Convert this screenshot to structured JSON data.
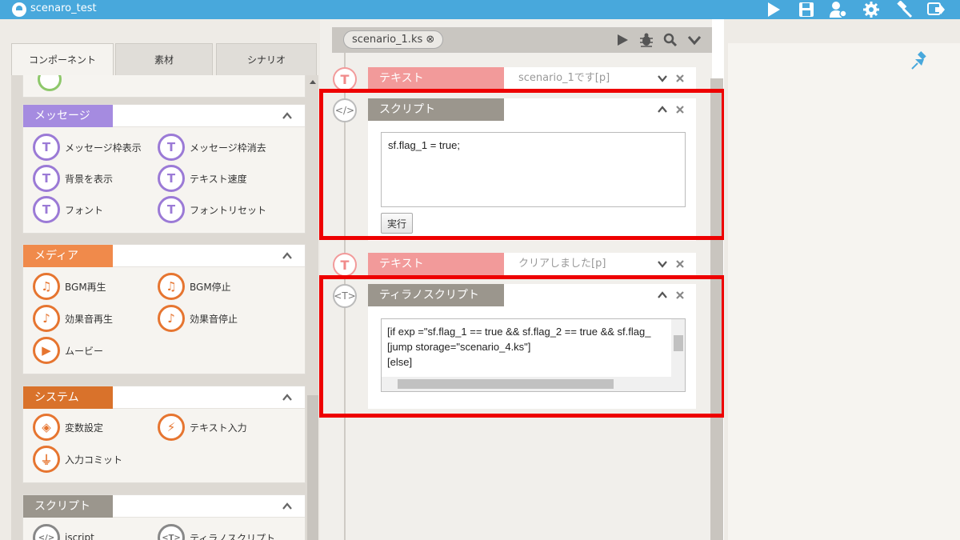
{
  "app": {
    "title": "scenaro_test"
  },
  "left": {
    "tabs": [
      "コンポーネント",
      "素材",
      "シナリオ"
    ],
    "categories": {
      "message": {
        "label": "メッセージ",
        "color": "#a58be0",
        "items": [
          "メッセージ枠表示",
          "メッセージ枠消去",
          "背景を表示",
          "テキスト速度",
          "フォント",
          "フォントリセット"
        ]
      },
      "media": {
        "label": "メディア",
        "color": "#f08a4b",
        "items": [
          "BGM再生",
          "BGM停止",
          "効果音再生",
          "効果音停止",
          "ムービー"
        ]
      },
      "system": {
        "label": "システム",
        "color": "#d9722b",
        "items": [
          "変数設定",
          "テキスト入力",
          "入力コミット"
        ]
      },
      "script": {
        "label": "スクリプト",
        "color": "#9b968d",
        "items": [
          "iscript",
          "ティラノスクリプト"
        ]
      }
    }
  },
  "center": {
    "file_tab": "scenario_1.ks",
    "blocks": {
      "text1": {
        "label": "テキスト",
        "value": "scenario_1です[p]"
      },
      "script": {
        "label": "スクリプト",
        "code": "sf.flag_1 = true;",
        "run": "実行"
      },
      "text2": {
        "label": "テキスト",
        "value": "クリアしました[p]"
      },
      "tyrano": {
        "label": "ティラノスクリプト",
        "lines": [
          "[if exp =\"sf.flag_1 == true && sf.flag_2 == true && sf.flag_",
          "[jump storage=\"scenario_4.ks\"]",
          "[else]"
        ]
      }
    }
  },
  "colors": {
    "topbar": "#48a8dc",
    "text_block": "#f29a9a",
    "script_block": "#9b968d",
    "highlight": "#ee0000"
  }
}
